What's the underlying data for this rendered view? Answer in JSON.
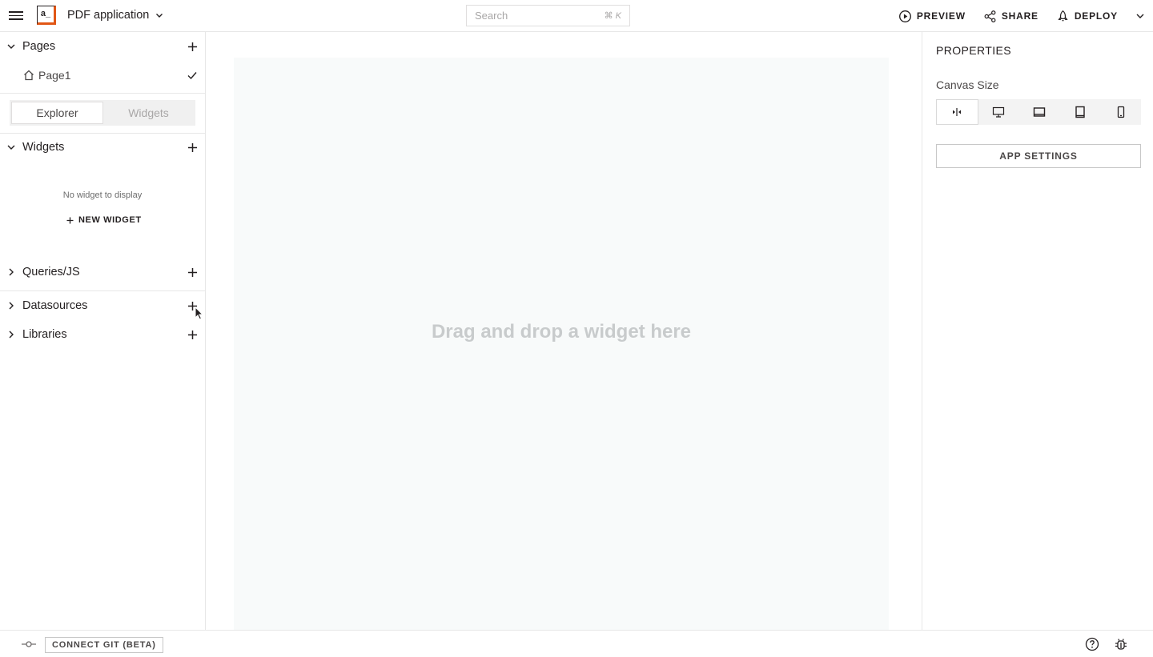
{
  "header": {
    "logo_text": "a_",
    "app_name": "PDF application",
    "search_placeholder": "Search",
    "search_shortcut": "⌘ K",
    "preview_label": "PREVIEW",
    "share_label": "SHARE",
    "deploy_label": "DEPLOY"
  },
  "sidebar": {
    "pages_label": "Pages",
    "pages": [
      {
        "label": "Page1",
        "active": true
      }
    ],
    "tabs": [
      {
        "label": "Explorer",
        "active": true
      },
      {
        "label": "Widgets",
        "active": false
      }
    ],
    "widgets_label": "Widgets",
    "empty_widgets_message": "No widget to display",
    "new_widget_label": "NEW WIDGET",
    "queries_label": "Queries/JS",
    "datasources_label": "Datasources",
    "libraries_label": "Libraries"
  },
  "canvas": {
    "placeholder": "Drag and drop a widget here"
  },
  "properties": {
    "title": "PROPERTIES",
    "canvas_size_label": "Canvas Size",
    "size_options": [
      "fluid-width-icon",
      "desktop-icon",
      "tablet-landscape-icon",
      "tablet-portrait-icon",
      "mobile-icon"
    ],
    "active_size": "fluid-width-icon",
    "app_settings_label": "APP SETTINGS"
  },
  "bottom_bar": {
    "connect_git_label": "CONNECT GIT (BETA)"
  },
  "colors": {
    "brand_accent": "#e15615",
    "text_primary": "#231f20",
    "canvas_bg": "#f8fafa",
    "canvas_placeholder": "#c8cbcc"
  }
}
